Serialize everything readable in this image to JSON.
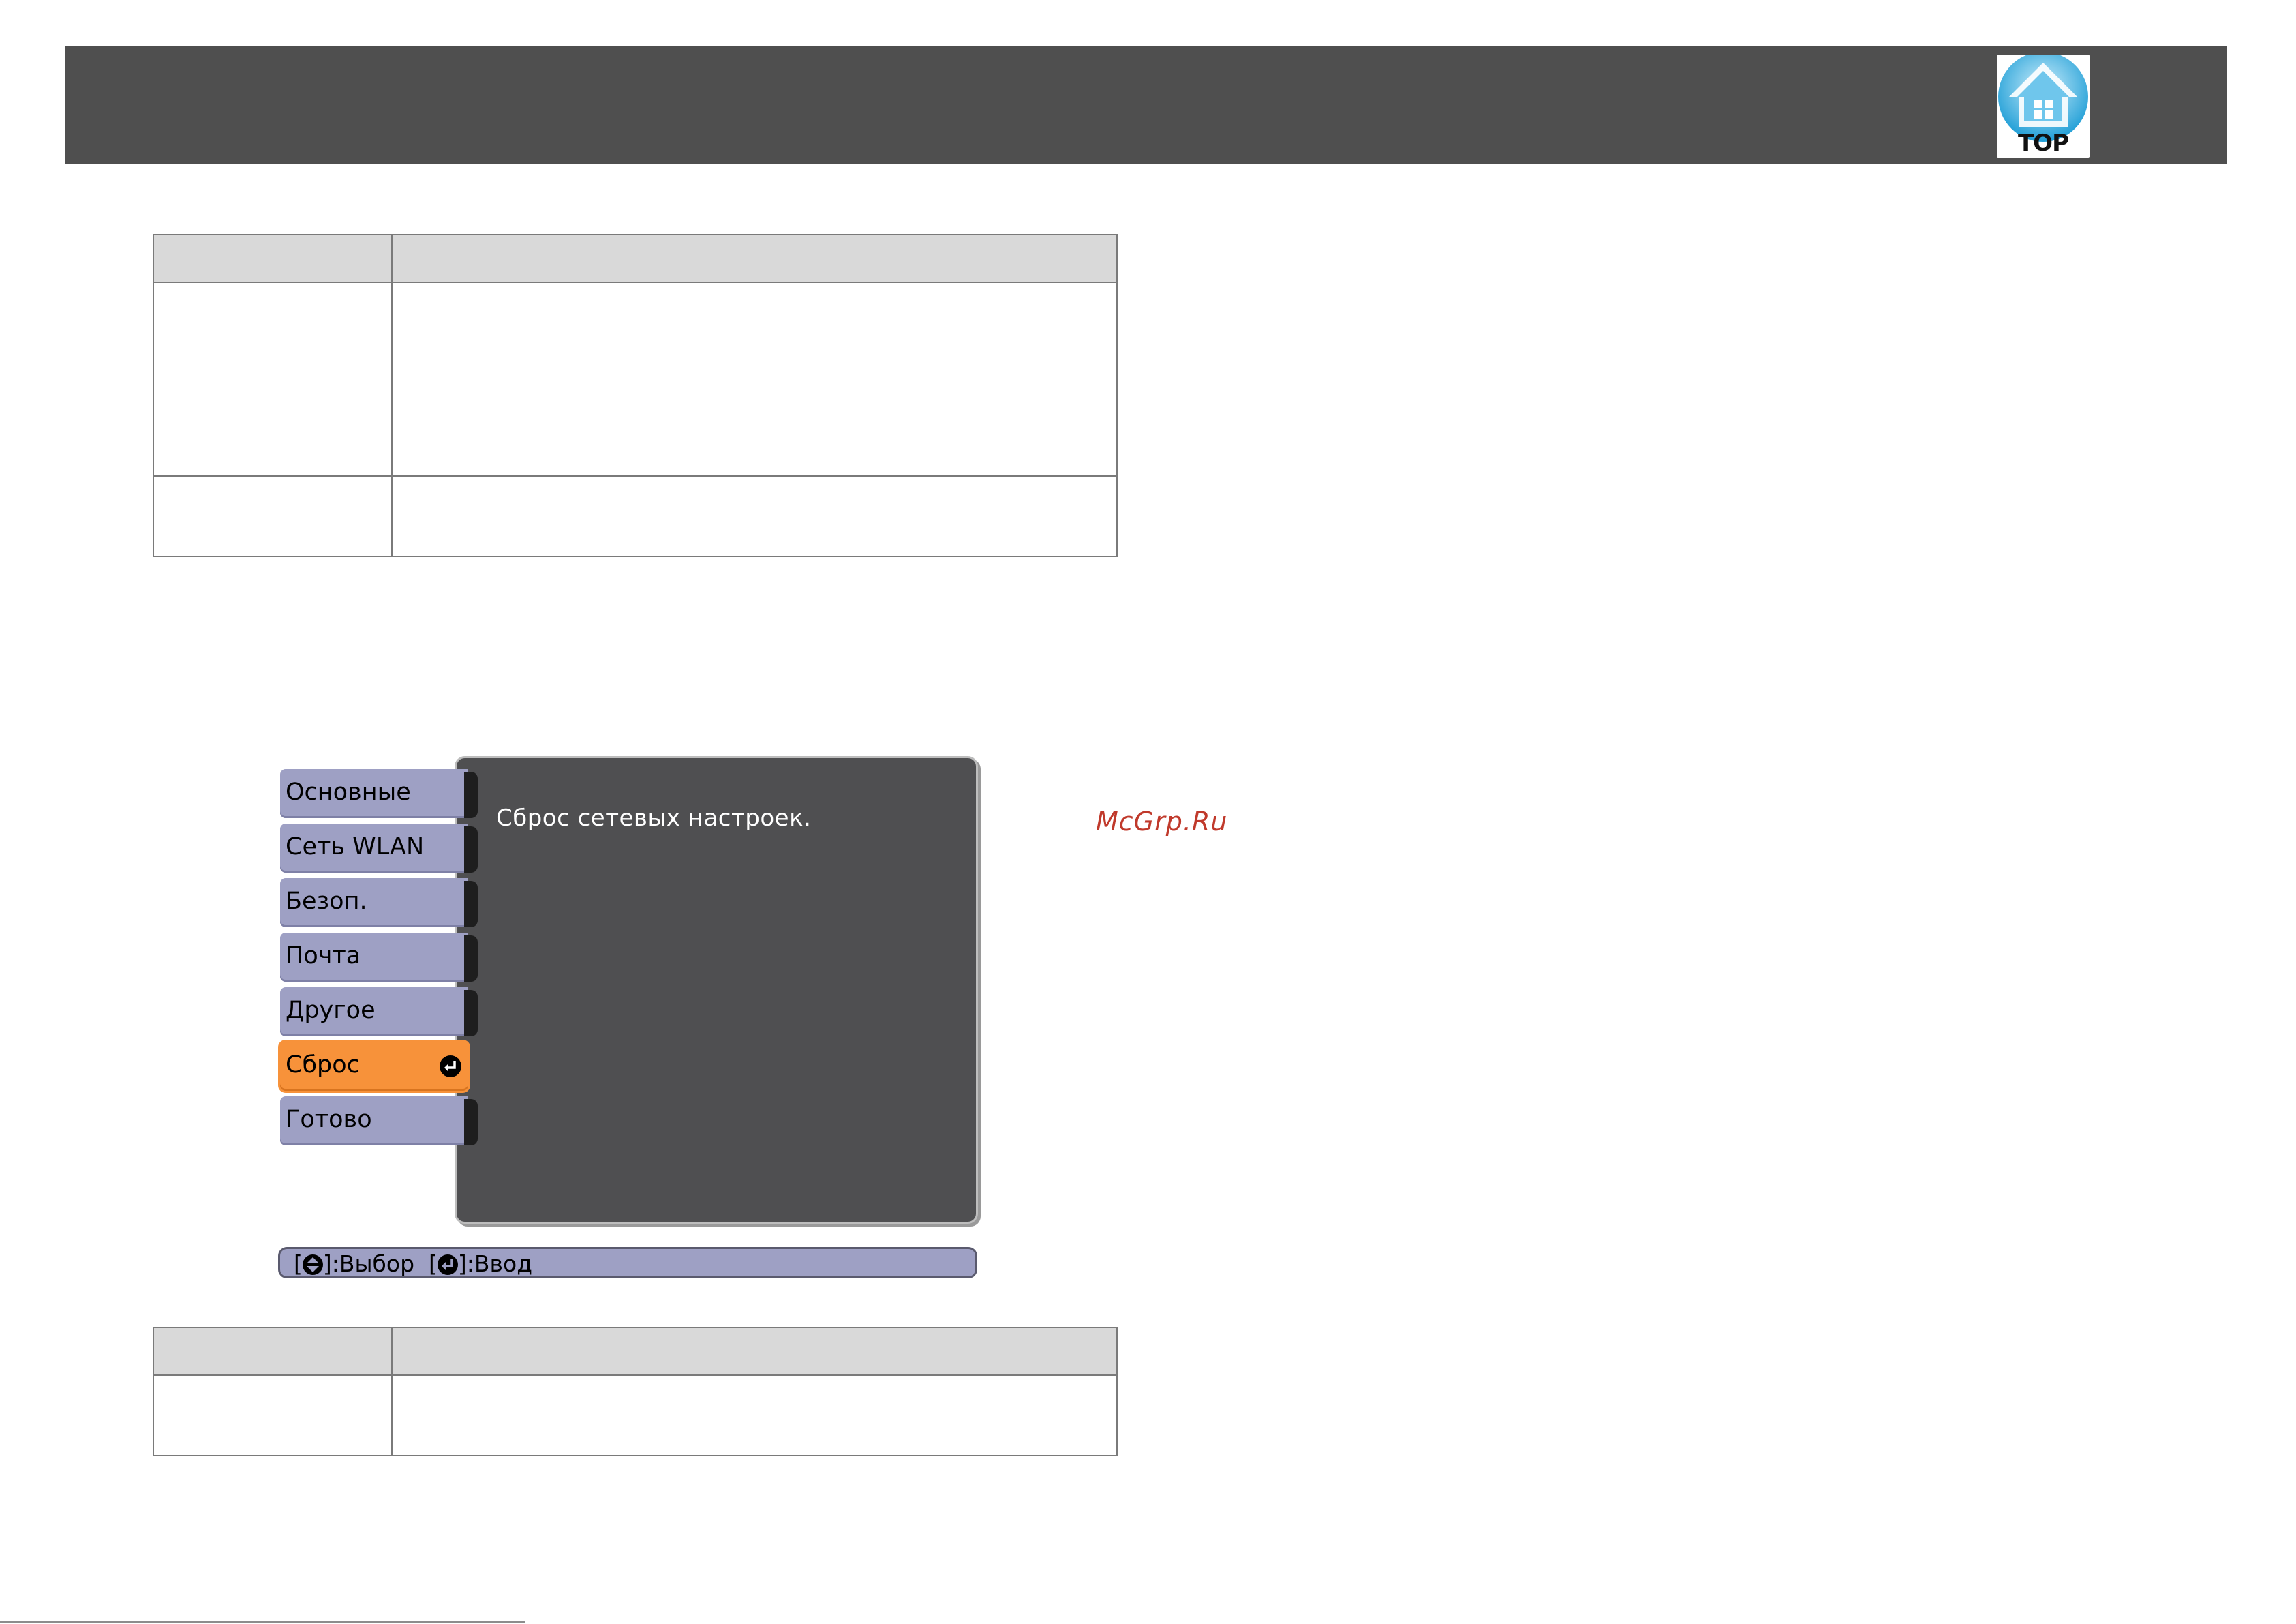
{
  "header": {
    "top_label": "TOP"
  },
  "projector_menu": {
    "tabs": [
      {
        "label": "Основные",
        "active": false
      },
      {
        "label": "Сеть WLAN",
        "active": false
      },
      {
        "label": "Безоп.",
        "active": false
      },
      {
        "label": "Почта",
        "active": false
      },
      {
        "label": "Другое",
        "active": false
      },
      {
        "label": "Сброс",
        "active": true
      },
      {
        "label": "Готово",
        "active": false
      }
    ],
    "description": "Сброс сетевых настроек.",
    "status_bar": {
      "select_open": "[",
      "select_close": "]:Выбор",
      "enter_open": "[",
      "enter_close": "]:Ввод"
    }
  },
  "watermark": "McGrp.Ru",
  "colors": {
    "header_bg": "#4f4f4f",
    "panel_bg": "#4f4f51",
    "tab_bg": "#9ea0c4",
    "tab_active_bg": "#f7923a",
    "table_header_bg": "#d9d9d9",
    "watermark": "#c0392b"
  }
}
